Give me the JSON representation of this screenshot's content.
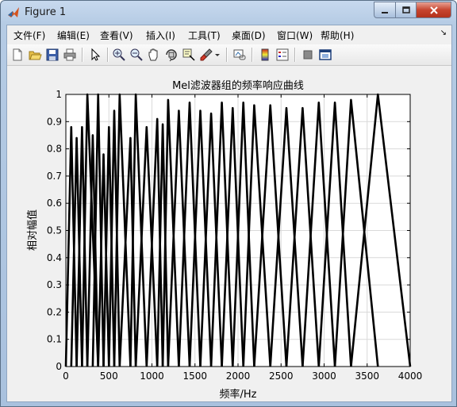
{
  "window": {
    "title": "Figure 1"
  },
  "menu": [
    {
      "label": "文件(F)"
    },
    {
      "label": "编辑(E)"
    },
    {
      "label": "查看(V)"
    },
    {
      "label": "插入(I)"
    },
    {
      "label": "工具(T)"
    },
    {
      "label": "桌面(D)"
    },
    {
      "label": "窗口(W)"
    },
    {
      "label": "帮助(H)"
    }
  ],
  "toolbar": [
    {
      "icon": "new-figure-icon"
    },
    {
      "icon": "open-file-icon"
    },
    {
      "icon": "save-icon"
    },
    {
      "icon": "print-icon"
    },
    {
      "icon": "edit-plot-arrow-icon"
    },
    {
      "icon": "zoom-in-icon"
    },
    {
      "icon": "zoom-out-icon"
    },
    {
      "icon": "pan-hand-icon"
    },
    {
      "icon": "rotate-3d-icon"
    },
    {
      "icon": "data-cursor-icon"
    },
    {
      "icon": "brush-icon"
    },
    {
      "icon": "link-plot-icon"
    },
    {
      "icon": "insert-colorbar-icon"
    },
    {
      "icon": "insert-legend-icon"
    },
    {
      "icon": "hide-plot-tools-icon"
    },
    {
      "icon": "show-plot-tools-icon"
    }
  ],
  "chart_data": {
    "type": "line",
    "title": "Mel滤波器组的频率响应曲线",
    "xlabel": "频率/Hz",
    "ylabel": "相对幅值",
    "xlim": [
      0,
      4000
    ],
    "ylim": [
      0,
      1
    ],
    "xticks": [
      0,
      500,
      1000,
      1500,
      2000,
      2500,
      3000,
      3500,
      4000
    ],
    "yticks": [
      0,
      0.1,
      0.2,
      0.3,
      0.4,
      0.5,
      0.6,
      0.7,
      0.8,
      0.9,
      1
    ],
    "grid": true,
    "line_color": "#000000",
    "filters": [
      {
        "left": 0,
        "center": 62.5,
        "right": 125,
        "peak": 0.88
      },
      {
        "left": 62.5,
        "center": 125,
        "right": 188,
        "peak": 0.84
      },
      {
        "left": 125,
        "center": 188,
        "right": 250,
        "peak": 0.88
      },
      {
        "left": 188,
        "center": 250,
        "right": 375,
        "peak": 1.0
      },
      {
        "left": 250,
        "center": 312.5,
        "right": 375,
        "peak": 0.85
      },
      {
        "left": 312.5,
        "center": 375,
        "right": 438,
        "peak": 1.0
      },
      {
        "left": 375,
        "center": 438,
        "right": 500,
        "peak": 0.78
      },
      {
        "left": 438,
        "center": 500,
        "right": 562,
        "peak": 0.88
      },
      {
        "left": 500,
        "center": 562,
        "right": 625,
        "peak": 0.94
      },
      {
        "left": 562,
        "center": 625,
        "right": 750,
        "peak": 1.0
      },
      {
        "left": 625,
        "center": 750,
        "right": 812,
        "peak": 0.84
      },
      {
        "left": 750,
        "center": 812,
        "right": 938,
        "peak": 1.0
      },
      {
        "left": 812,
        "center": 938,
        "right": 1062,
        "peak": 0.88
      },
      {
        "left": 938,
        "center": 1062,
        "right": 1125,
        "peak": 0.91
      },
      {
        "left": 1062,
        "center": 1125,
        "right": 1188,
        "peak": 0.89
      },
      {
        "left": 1125,
        "center": 1188,
        "right": 1312,
        "peak": 0.98
      },
      {
        "left": 1188,
        "center": 1312,
        "right": 1438,
        "peak": 0.94
      },
      {
        "left": 1312,
        "center": 1438,
        "right": 1562,
        "peak": 0.97
      },
      {
        "left": 1438,
        "center": 1562,
        "right": 1688,
        "peak": 0.94
      },
      {
        "left": 1562,
        "center": 1688,
        "right": 1812,
        "peak": 0.93
      },
      {
        "left": 1688,
        "center": 1812,
        "right": 1938,
        "peak": 0.97
      },
      {
        "left": 1812,
        "center": 1938,
        "right": 2062,
        "peak": 0.95
      },
      {
        "left": 1938,
        "center": 2062,
        "right": 2188,
        "peak": 0.97
      },
      {
        "left": 2062,
        "center": 2188,
        "right": 2375,
        "peak": 0.96
      },
      {
        "left": 2188,
        "center": 2375,
        "right": 2562,
        "peak": 0.96
      },
      {
        "left": 2375,
        "center": 2562,
        "right": 2750,
        "peak": 0.95
      },
      {
        "left": 2562,
        "center": 2750,
        "right": 2938,
        "peak": 0.95
      },
      {
        "left": 2750,
        "center": 2938,
        "right": 3125,
        "peak": 0.97
      },
      {
        "left": 2938,
        "center": 3125,
        "right": 3312,
        "peak": 0.97
      },
      {
        "left": 3125,
        "center": 3312,
        "right": 3625,
        "peak": 0.98
      },
      {
        "left": 3312,
        "center": 3625,
        "right": 4000,
        "peak": 1.0
      }
    ]
  }
}
